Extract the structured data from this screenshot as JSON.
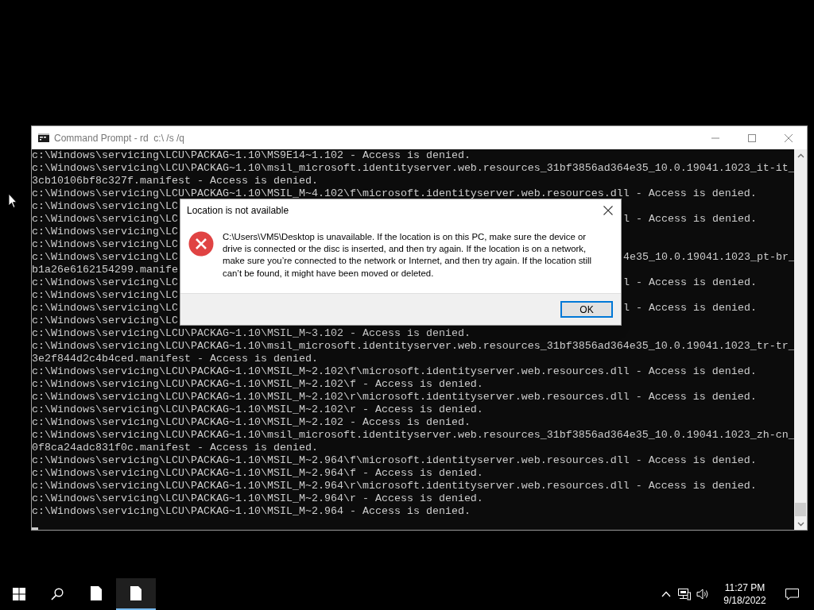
{
  "window": {
    "title": "Command Prompt - rd  c:\\ /s /q"
  },
  "console": {
    "lines": [
      {
        "text": "c:\\Windows\\servicing\\LCU\\PACKAG~1.10\\MS9E14~1.102 - Access is denied."
      },
      {
        "text": "c:\\Windows\\servicing\\LCU\\PACKAG~1.10\\msil_microsoft.identityserver.web.resources_31bf3856ad364e35_10.0.19041.1023_it-it_"
      },
      {
        "text": "3cb10106bf8c327f.manifest - Access is denied."
      },
      {
        "text": "c:\\Windows\\servicing\\LCU\\PACKAG~1.10\\MSIL_M~4.102\\f\\microsoft.identityserver.web.resources.dll - Access is denied."
      },
      {
        "text": "c:\\Windows\\servicing\\LC"
      },
      {
        "text": "c:\\Windows\\servicing\\LC",
        "right": "l - Access is denied."
      },
      {
        "text": "c:\\Windows\\servicing\\LC"
      },
      {
        "text": "c:\\Windows\\servicing\\LC"
      },
      {
        "text": "c:\\Windows\\servicing\\LC",
        "right": "4e35_10.0.19041.1023_pt-br_"
      },
      {
        "text": "b1a26e6162154299.manife"
      },
      {
        "text": "c:\\Windows\\servicing\\LC",
        "right": "l - Access is denied."
      },
      {
        "text": "c:\\Windows\\servicing\\LC"
      },
      {
        "text": "c:\\Windows\\servicing\\LC",
        "right": "l - Access is denied."
      },
      {
        "text": "c:\\Windows\\servicing\\LC"
      },
      {
        "text": "c:\\Windows\\servicing\\LCU\\PACKAG~1.10\\MSIL_M~3.102 - Access is denied."
      },
      {
        "text": "c:\\Windows\\servicing\\LCU\\PACKAG~1.10\\msil_microsoft.identityserver.web.resources_31bf3856ad364e35_10.0.19041.1023_tr-tr_"
      },
      {
        "text": "3e2f844d2c4b4ced.manifest - Access is denied."
      },
      {
        "text": "c:\\Windows\\servicing\\LCU\\PACKAG~1.10\\MSIL_M~2.102\\f\\microsoft.identityserver.web.resources.dll - Access is denied."
      },
      {
        "text": "c:\\Windows\\servicing\\LCU\\PACKAG~1.10\\MSIL_M~2.102\\f - Access is denied."
      },
      {
        "text": "c:\\Windows\\servicing\\LCU\\PACKAG~1.10\\MSIL_M~2.102\\r\\microsoft.identityserver.web.resources.dll - Access is denied."
      },
      {
        "text": "c:\\Windows\\servicing\\LCU\\PACKAG~1.10\\MSIL_M~2.102\\r - Access is denied."
      },
      {
        "text": "c:\\Windows\\servicing\\LCU\\PACKAG~1.10\\MSIL_M~2.102 - Access is denied."
      },
      {
        "text": "c:\\Windows\\servicing\\LCU\\PACKAG~1.10\\msil_microsoft.identityserver.web.resources_31bf3856ad364e35_10.0.19041.1023_zh-cn_"
      },
      {
        "text": "0f8ca24adc831f0c.manifest - Access is denied."
      },
      {
        "text": "c:\\Windows\\servicing\\LCU\\PACKAG~1.10\\MSIL_M~2.964\\f\\microsoft.identityserver.web.resources.dll - Access is denied."
      },
      {
        "text": "c:\\Windows\\servicing\\LCU\\PACKAG~1.10\\MSIL_M~2.964\\f - Access is denied."
      },
      {
        "text": "c:\\Windows\\servicing\\LCU\\PACKAG~1.10\\MSIL_M~2.964\\r\\microsoft.identityserver.web.resources.dll - Access is denied."
      },
      {
        "text": "c:\\Windows\\servicing\\LCU\\PACKAG~1.10\\MSIL_M~2.964\\r - Access is denied."
      },
      {
        "text": "c:\\Windows\\servicing\\LCU\\PACKAG~1.10\\MSIL_M~2.964 - Access is denied."
      }
    ]
  },
  "dialog": {
    "title": "Location is not available",
    "message": "C:\\Users\\VM5\\Desktop is unavailable. If the location is on this PC, make sure the device or drive is connected or the disc is inserted, and then try again. If the location is on a network, make sure you’re connected to the network or Internet, and then try again. If the location still can’t be found, it might have been moved or deleted.",
    "buttons": [
      "OK"
    ]
  },
  "taskbar": {
    "apps": [
      {
        "selected": false
      },
      {
        "selected": true
      }
    ],
    "time": "11:27 PM",
    "date": "9/18/2022"
  }
}
